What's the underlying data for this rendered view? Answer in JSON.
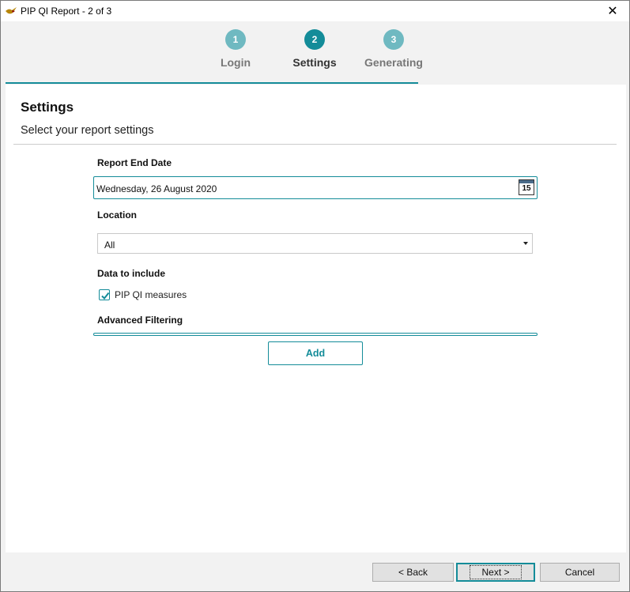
{
  "window": {
    "title": "PIP QI Report - 2 of 3",
    "close_label": "✕"
  },
  "stepper": {
    "steps": [
      {
        "number": "1",
        "label": "Login",
        "color": "#6fb9c1"
      },
      {
        "number": "2",
        "label": "Settings",
        "color": "#148c99"
      },
      {
        "number": "3",
        "label": "Generating",
        "color": "#6fb9c1"
      }
    ],
    "progress_fraction": 0.66
  },
  "page": {
    "title": "Settings",
    "subtitle": "Select your report settings"
  },
  "form": {
    "report_end_date": {
      "label": "Report End Date",
      "value": "Wednesday, 26 August 2020",
      "calendar_day": "15"
    },
    "location": {
      "label": "Location",
      "value": "All"
    },
    "data_to_include": {
      "label": "Data to include",
      "options": [
        {
          "label": "PIP QI measures",
          "checked": true
        }
      ]
    },
    "advanced_filtering": {
      "label": "Advanced Filtering",
      "add_label": "Add"
    }
  },
  "footer": {
    "back_label": "< Back",
    "next_label": "Next >",
    "cancel_label": "Cancel"
  },
  "colors": {
    "accent": "#148c99",
    "step_inactive": "#6fb9c1"
  }
}
